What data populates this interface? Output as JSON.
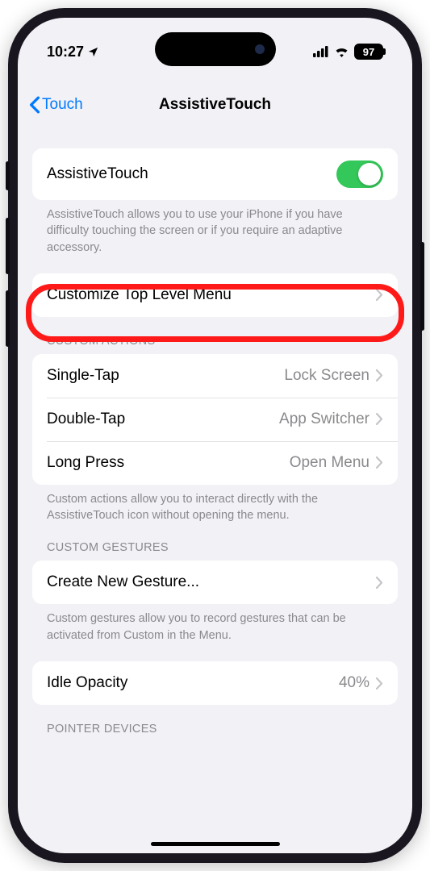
{
  "status": {
    "time": "10:27",
    "battery": "97"
  },
  "nav": {
    "back": "Touch",
    "title": "AssistiveTouch"
  },
  "toggle": {
    "label": "AssistiveTouch",
    "desc": "AssistiveTouch allows you to use your iPhone if you have difficulty touching the screen or if you require an adaptive accessory."
  },
  "customize_menu": "Customize Top Level Menu",
  "actions": {
    "header": "CUSTOM ACTIONS",
    "single_label": "Single-Tap",
    "single_value": "Lock Screen",
    "double_label": "Double-Tap",
    "double_value": "App Switcher",
    "long_label": "Long Press",
    "long_value": "Open Menu",
    "footer": "Custom actions allow you to interact directly with the AssistiveTouch icon without opening the menu."
  },
  "gestures": {
    "header": "CUSTOM GESTURES",
    "create": "Create New Gesture...",
    "footer": "Custom gestures allow you to record gestures that can be activated from Custom in the Menu."
  },
  "idle": {
    "label": "Idle Opacity",
    "value": "40%"
  },
  "pointer_header": "POINTER DEVICES"
}
